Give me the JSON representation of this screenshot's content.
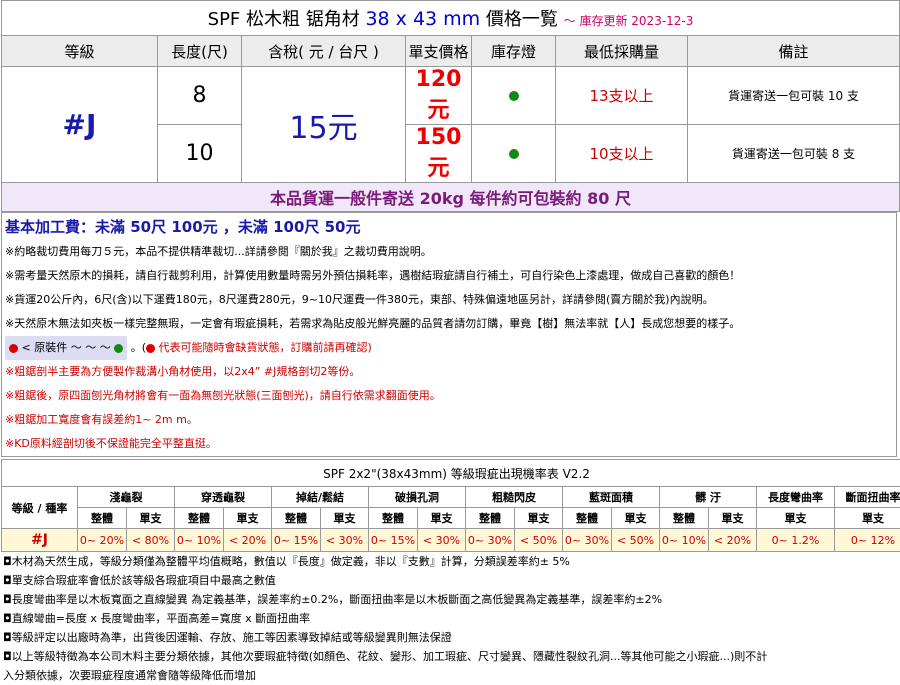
{
  "header": {
    "title_main": "SPF  松木粗 锯角材",
    "title_dims": "38 x 43 mm",
    "title_suffix": "價格一覧",
    "update": "～ 庫存更新 2023-12-3"
  },
  "columns": [
    "等級",
    "長度(尺)",
    "含稅( 元 / 台尺 )",
    "單支價格",
    "庫存燈",
    "最低採購量",
    "備註"
  ],
  "grade": "#J",
  "price_per_unit": "15元",
  "rows": [
    {
      "length": "8",
      "single_price": "120元",
      "min_purchase": "13支以上",
      "note": "貨運寄送一包可裝 10 支"
    },
    {
      "length": "10",
      "single_price": "150元",
      "min_purchase": "10支以上",
      "note": "貨運寄送一包可裝 8 支"
    }
  ],
  "stock_color": "#118811",
  "shipping_line": "本品貨運一般件寄送 20kg 每件約可包裝約 80 尺",
  "info": {
    "fee": "基本加工費：未滿 50尺 100元 ，未滿 100尺 50元",
    "lines": [
      "※約略裁切費用每刀５元，本品不提供精準裁切...詳請參閱『關於我』之裁切費用說明。",
      "※需考量天然原木的損耗，請自行裁剪利用，計算使用數量時需另外預估損耗率，遇樹結瑕疵請自行補土，可自行染色上漆處理，做成自己喜歡的顏色！",
      "※貨運20公斤內，6尺(含)以下運費180元，8尺運費280元，9~10尺運費一件380元，東部、特殊偏遠地區另計，詳請參閱(賣方關於我)內說明。",
      "※天然原木無法如夾板一樣完整無瑕，一定會有瑕疵損耗，若需求為貼皮般光鮮亮麗的品質者請勿訂購，畢竟【樹】無法率就【人】長成您想要的樣子。"
    ],
    "legend_label": "< 原裝件 ～ ～ ～",
    "legend_note": "代表可能隨時會缺貨狀態，訂購前請再確認)",
    "red_lines": [
      "※粗鋸剖半主要為方便製作裁溝小角材使用，以2x4” #J規格剖切2等份。",
      "※粗鋸後，原四面刨光角材將會有一面為無刨光狀態(三面刨光)，請自行依需求翻面使用。",
      "※粗鋸加工寬度會有誤差約1~ 2m m。",
      "※KD原料經剖切後不保證能完全平整直挺。"
    ]
  },
  "defect_table": {
    "title": "SPF 2x2\"(38x43mm) 等級瑕疵出現機率表 V2.2",
    "row_header": "等級 / 種率",
    "groups": [
      "淺龜裂",
      "穿透龜裂",
      "掉結/鬆結",
      "破損孔洞",
      "粗糙閃皮",
      "藍斑面積",
      "髒 汙",
      "長度彎曲率",
      "斷面扭曲率"
    ],
    "sub_whole": "整體",
    "sub_single": "單支",
    "grade": "#J",
    "values": [
      "0~ 20%",
      "< 80%",
      "0~ 10%",
      "< 20%",
      "0~ 15%",
      "< 30%",
      "0~ 15%",
      "< 30%",
      "0~ 30%",
      "< 50%",
      "0~ 30%",
      "< 50%",
      "0~ 10%",
      "< 20%",
      "0~ 1.2%",
      "0~ 12%"
    ]
  },
  "footnotes": [
    "◘木材為天然生成，等級分類僅為整體平均值概略，數值以『長度』做定義，非以『支數』計算，分類誤差率約± 5%",
    "◘單支綜合瑕疵率會低於該等級各瑕疵項目中最高之數值",
    "◘長度彎曲率是以木板寬面之直線變異 為定義基準，誤差率約±0.2%，斷面扭曲率是以木板斷面之高低變異為定義基準，誤差率約±2%",
    "◘直線彎曲=長度 x 長度彎曲率，平面高差=寬度 x 斷面扭曲率",
    "◘等級評定以出廠時為準，出貨後因運輸、存放、施工等因素導致掉結或等級變異則無法保證",
    "◘以上等級特徵為本公司木料主要分類依據，其他次要瑕疵特徵(如顏色、花紋、變形、加工瑕疵、尺寸變異、隱藏性裂紋孔洞...等其他可能之小瑕疵...)則不計",
    "入分類依據，次要瑕疵程度通常會隨等級降低而增加"
  ]
}
